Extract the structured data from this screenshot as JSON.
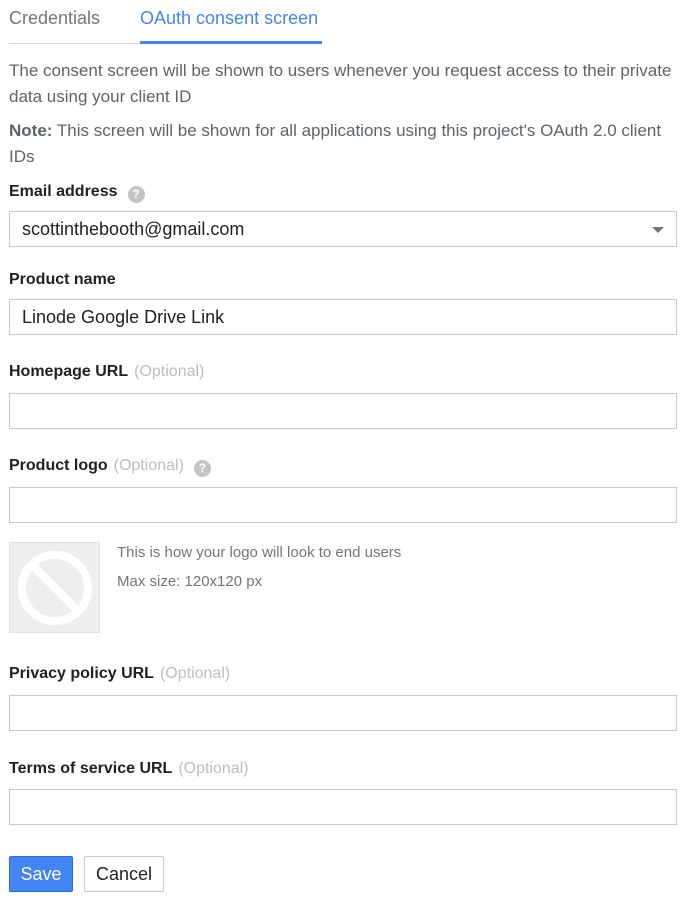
{
  "tabs": [
    {
      "label": "Credentials",
      "active": false
    },
    {
      "label": "OAuth consent screen",
      "active": true
    }
  ],
  "intro": "The consent screen will be shown to users whenever you request access to their private data using your client ID",
  "note": {
    "prefix": "Note:",
    "text": " This screen will be shown for all applications using this project's OAuth 2.0 client IDs"
  },
  "email": {
    "label": "Email address",
    "value": "scottinthebooth@gmail.com",
    "help_icon": "help-icon"
  },
  "product_name": {
    "label": "Product name",
    "value": "Linode Google Drive Link"
  },
  "homepage": {
    "label": "Homepage URL",
    "optional": "(Optional)",
    "value": ""
  },
  "product_logo": {
    "label": "Product logo",
    "optional": "(Optional)",
    "value": "",
    "help_icon": "help-icon",
    "preview_icon": "no-image-icon",
    "preview_text": "This is how your logo will look to end users",
    "max_size": "Max size: 120x120 px"
  },
  "privacy": {
    "label": "Privacy policy URL",
    "optional": "(Optional)",
    "value": ""
  },
  "terms": {
    "label": "Terms of service URL",
    "optional": "(Optional)",
    "value": ""
  },
  "actions": {
    "save_label": "Save",
    "cancel_label": "Cancel"
  },
  "colors": {
    "accent": "#4285f4",
    "text": "#212121",
    "muted": "#757575",
    "optional": "#bdbdbd",
    "border": "#c8c8c8"
  }
}
